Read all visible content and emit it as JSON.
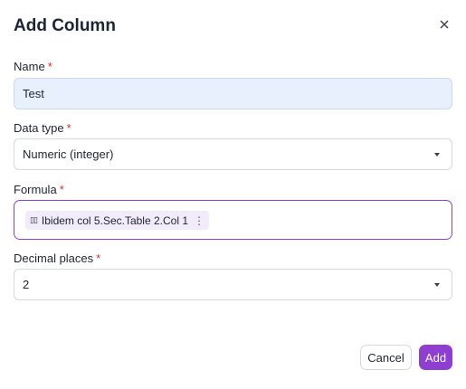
{
  "dialog": {
    "title": "Add Column",
    "close_icon": "close-icon",
    "required_marker": "*"
  },
  "name": {
    "label": "Name",
    "value": "Test"
  },
  "data_type": {
    "label": "Data type",
    "selected": "Numeric (integer)"
  },
  "formula": {
    "label": "Formula",
    "chip_icon_glyph": "▯▯",
    "chip_text": "Ibidem col 5.Sec.Table 2.Col 1",
    "chip_menu_glyph": "⋮"
  },
  "decimal_places": {
    "label": "Decimal places",
    "selected": "2"
  },
  "buttons": {
    "cancel": "Cancel",
    "add": "Add"
  },
  "colors": {
    "accent": "#8e3fd1",
    "required": "#d4351c",
    "name_field_bg": "#e8effd",
    "chip_bg": "#f1ebfa"
  }
}
